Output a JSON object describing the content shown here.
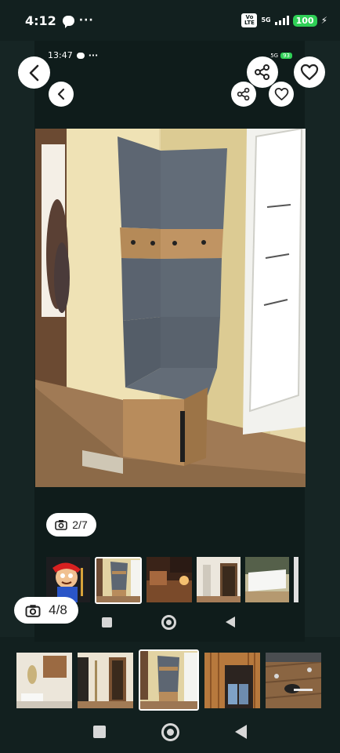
{
  "status_bar": {
    "time": "4:12",
    "network": "5G",
    "volte": "Vo LTE",
    "battery": "100"
  },
  "inner_status_bar": {
    "time": "13:47",
    "network": "5G",
    "battery": "93"
  },
  "counters": {
    "inner": "2/7",
    "outer": "4/8"
  },
  "icons": {
    "back": "chevron-left-icon",
    "share": "share-icon",
    "favorite": "heart-icon",
    "camera": "camera-icon",
    "home": "circle-icon",
    "recents": "square-icon",
    "nav_back": "triangle-back-icon"
  },
  "colors": {
    "background": "#12201f",
    "inner_background": "#0f1c1b",
    "battery_green": "#2fcf56",
    "accent": "#ffffff"
  }
}
